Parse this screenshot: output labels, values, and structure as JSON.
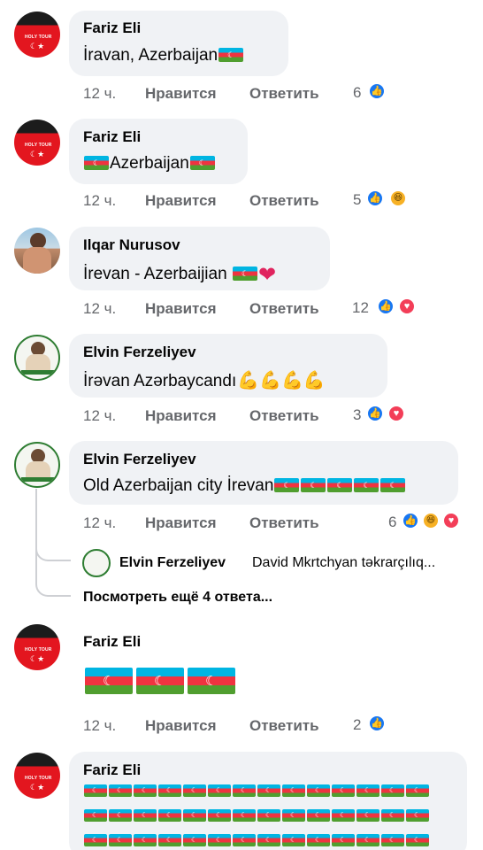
{
  "comments": [
    {
      "author": "Fariz Eli",
      "avatar": "red-flag-avatar",
      "text": "İravan, Azerbaijan",
      "time": "12 ч.",
      "like": "Нравится",
      "reply": "Ответить",
      "reaction_count": "6",
      "reactions": [
        "like"
      ]
    },
    {
      "author": "Fariz Eli",
      "avatar": "red-flag-avatar",
      "text": "Azerbaijan",
      "time": "12 ч.",
      "like": "Нравится",
      "reply": "Ответить",
      "reaction_count": "5",
      "reactions": [
        "like",
        "haha"
      ]
    },
    {
      "author": "Ilqar Nurusov",
      "avatar": "photo-avatar",
      "text": "İrevan - Azerbaijian",
      "time": "12 ч.",
      "like": "Нравится",
      "reply": "Ответить",
      "reaction_count": "12",
      "reactions": [
        "like",
        "love"
      ]
    },
    {
      "author": "Elvin Ferzeliyev",
      "avatar": "badge-avatar",
      "text": "İrəvan Azərbaycandı",
      "time": "12 ч.",
      "like": "Нравится",
      "reply": "Ответить",
      "reaction_count": "3",
      "reactions": [
        "like",
        "love"
      ]
    },
    {
      "author": "Elvin Ferzeliyev",
      "avatar": "badge-avatar",
      "text": "Old Azerbaijan city İrevan",
      "time": "12 ч.",
      "like": "Нравится",
      "reply": "Ответить",
      "reaction_count": "6",
      "reactions": [
        "like",
        "haha",
        "love"
      ]
    },
    {
      "author": "Fariz Eli",
      "avatar": "red-flag-avatar",
      "text": "",
      "time": "12 ч.",
      "like": "Нравится",
      "reply": "Ответить",
      "reaction_count": "2",
      "reactions": [
        "like"
      ]
    },
    {
      "author": "Fariz Eli",
      "avatar": "red-flag-avatar",
      "text": ""
    }
  ],
  "reply_preview": {
    "author": "Elvin Ferzeliyev",
    "text": "David Mkrtchyan təkrarçılıq..."
  },
  "more_replies": "Посмотреть ещё 4 ответа...",
  "colors": {
    "bubble": "#f0f2f5",
    "meta": "#65676b",
    "like": "#1877f2",
    "love": "#f33e58",
    "haha": "#f7b125"
  }
}
